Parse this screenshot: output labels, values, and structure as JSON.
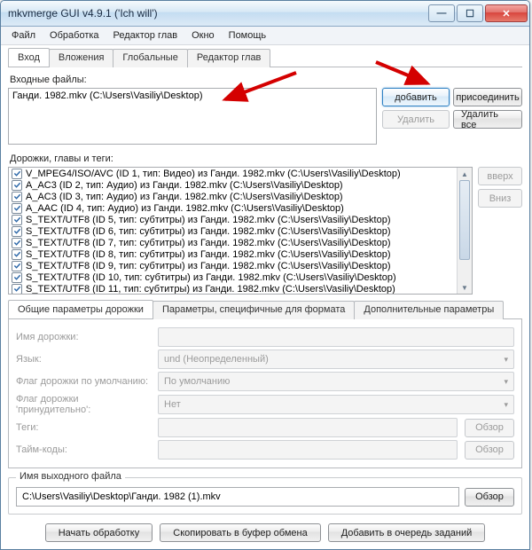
{
  "window": {
    "title": "mkvmerge GUI v4.9.1 ('Ich will')"
  },
  "menubar": [
    "Файл",
    "Обработка",
    "Редактор глав",
    "Окно",
    "Помощь"
  ],
  "tabs": {
    "items": [
      "Вход",
      "Вложения",
      "Глобальные",
      "Редактор глав"
    ],
    "active": 0
  },
  "input": {
    "label": "Входные файлы:",
    "file": "Ганди. 1982.mkv (C:\\Users\\Vasiliy\\Desktop)",
    "btn_add": "добавить",
    "btn_append": "присоединить",
    "btn_delete": "Удалить",
    "btn_delete_all": "Удалить все"
  },
  "tracks": {
    "label": "Дорожки, главы и теги:",
    "btn_up": "вверх",
    "btn_down": "Вниз",
    "items": [
      "V_MPEG4/ISO/AVC (ID 1, тип: Видео) из Ганди. 1982.mkv (C:\\Users\\Vasiliy\\Desktop)",
      "A_AC3 (ID 2, тип: Аудио) из Ганди. 1982.mkv (C:\\Users\\Vasiliy\\Desktop)",
      "A_AC3 (ID 3, тип: Аудио) из Ганди. 1982.mkv (C:\\Users\\Vasiliy\\Desktop)",
      "A_AAC (ID 4, тип: Аудио) из Ганди. 1982.mkv (C:\\Users\\Vasiliy\\Desktop)",
      "S_TEXT/UTF8 (ID 5, тип: субтитры) из Ганди. 1982.mkv (C:\\Users\\Vasiliy\\Desktop)",
      "S_TEXT/UTF8 (ID 6, тип: субтитры) из Ганди. 1982.mkv (C:\\Users\\Vasiliy\\Desktop)",
      "S_TEXT/UTF8 (ID 7, тип: субтитры) из Ганди. 1982.mkv (C:\\Users\\Vasiliy\\Desktop)",
      "S_TEXT/UTF8 (ID 8, тип: субтитры) из Ганди. 1982.mkv (C:\\Users\\Vasiliy\\Desktop)",
      "S_TEXT/UTF8 (ID 9, тип: субтитры) из Ганди. 1982.mkv (C:\\Users\\Vasiliy\\Desktop)",
      "S_TEXT/UTF8 (ID 10, тип: субтитры) из Ганди. 1982.mkv (C:\\Users\\Vasiliy\\Desktop)",
      "S_TEXT/UTF8 (ID 11, тип: субтитры) из Ганди. 1982.mkv (C:\\Users\\Vasiliy\\Desktop)"
    ]
  },
  "subtabs": [
    "Общие параметры дорожки",
    "Параметры, специфичные для формата",
    "Дополнительные параметры"
  ],
  "track_opts": {
    "name_label": "Имя дорожки:",
    "name_value": "",
    "lang_label": "Язык:",
    "lang_value": "und (Неопределенный)",
    "default_label": "Флаг дорожки по умолчанию:",
    "default_value": "По умолчанию",
    "forced_label": "Флаг дорожки 'принудительно':",
    "forced_value": "Нет",
    "tags_label": "Теги:",
    "tags_value": "",
    "tc_label": "Тайм-коды:",
    "tc_value": "",
    "browse": "Обзор"
  },
  "output": {
    "label": "Имя выходного файла",
    "value": "C:\\Users\\Vasiliy\\Desktop\\Ганди. 1982 (1).mkv",
    "browse": "Обзор"
  },
  "bottom": {
    "start": "Начать обработку",
    "copy": "Скопировать в буфер обмена",
    "queue": "Добавить в очередь заданий"
  },
  "winbtns": {
    "min": "—",
    "max": "☐",
    "close": "✕"
  }
}
